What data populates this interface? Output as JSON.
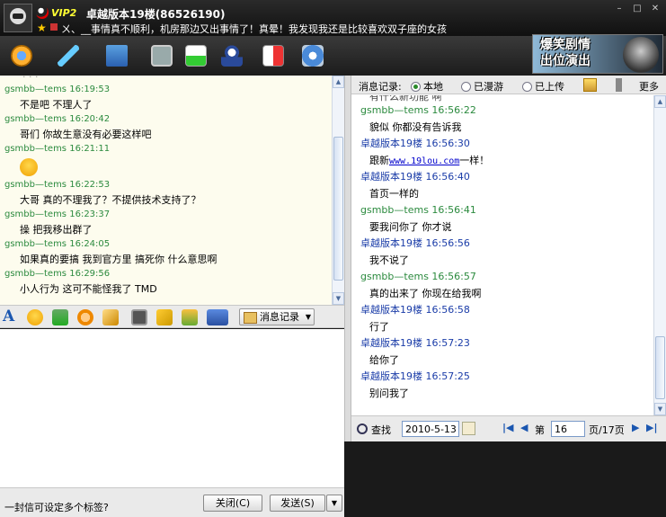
{
  "window": {
    "vip_label": "VIP2",
    "title": "卓越版本19楼(86526190)",
    "signature": "ㄨ、__事情真不顺利，机房那边又出事情了！真晕！我发现我还是比较喜欢双子座的女孩",
    "controls": [
      "–",
      "□",
      "✕"
    ]
  },
  "toolbar": {
    "icons": [
      "webcam-icon",
      "microphone-icon",
      "folder-icon",
      "video-icon",
      "application-icon",
      "user-icon",
      "game-icon",
      "settings-icon"
    ],
    "banner_line1": "爆笑剧情",
    "banner_line2": "出位演出"
  },
  "chat": {
    "messages": [
      {
        "sender": "gsmbb—tems",
        "time": "16:19:53",
        "text": "不是吧 不理人了"
      },
      {
        "sender": "gsmbb—tems",
        "time": "16:20:42",
        "text": "哥们 你故生意没有必要这样吧"
      },
      {
        "sender": "gsmbb—tems",
        "time": "16:21:11",
        "text": "",
        "emoji": true
      },
      {
        "sender": "gsmbb—tems",
        "time": "16:22:53",
        "text": "大哥 真的不理我了？不提供技术支持了？"
      },
      {
        "sender": "gsmbb—tems",
        "time": "16:23:37",
        "text": "操 把我移出群了"
      },
      {
        "sender": "gsmbb—tems",
        "time": "16:24:05",
        "text": "如果真的要搞 我到官方里 搞死你 什么意思啊"
      },
      {
        "sender": "gsmbb—tems",
        "time": "16:29:56",
        "text": "小人行为 这可不能怪我了 TMD"
      }
    ]
  },
  "format_bar": {
    "font_glyph": "A",
    "history_button": "消息记录"
  },
  "status": {
    "tip": "一封信可设定多个标签?",
    "close_button": "关闭(C)",
    "send_button": "发送(S)",
    "send_dropdown": "▼"
  },
  "history": {
    "label": "消息记录:",
    "options": [
      "本地",
      "已漫游",
      "已上传"
    ],
    "more": "更多",
    "first_line": "有什么新功能 啊",
    "messages": [
      {
        "sender": "gsmbb—tems",
        "time": "16:56:22",
        "text": "貌似 你都没有告诉我",
        "color": "g"
      },
      {
        "sender": "卓越版本19楼",
        "time": "16:56:30",
        "text": "跟新",
        "link": "www.19lou.com",
        "suffix": "一样！",
        "color": "b"
      },
      {
        "sender": "卓越版本19楼",
        "time": "16:56:40",
        "text": "首页一样的",
        "color": "b"
      },
      {
        "sender": "gsmbb—tems",
        "time": "16:56:41",
        "text": "要我问你了 你才说",
        "color": "g"
      },
      {
        "sender": "卓越版本19楼",
        "time": "16:56:56",
        "text": "我不说了",
        "color": "b"
      },
      {
        "sender": "gsmbb—tems",
        "time": "16:56:57",
        "text": "真的出来了 你现在给我啊",
        "color": "g"
      },
      {
        "sender": "卓越版本19楼",
        "time": "16:56:58",
        "text": "行了",
        "color": "b"
      },
      {
        "sender": "卓越版本19楼",
        "time": "16:57:23",
        "text": "给你了",
        "color": "b"
      },
      {
        "sender": "卓越版本19楼",
        "time": "16:57:25",
        "text": "别问我了",
        "color": "b"
      }
    ],
    "find_label": "查找",
    "date": "2010-5-13",
    "page_prefix": "第",
    "page": "16",
    "page_suffix": "页/17页"
  },
  "colors": {
    "sender_green": "#2b8a3e",
    "sender_blue": "#1a3ca8",
    "chat_bg": "#fdfcee"
  }
}
